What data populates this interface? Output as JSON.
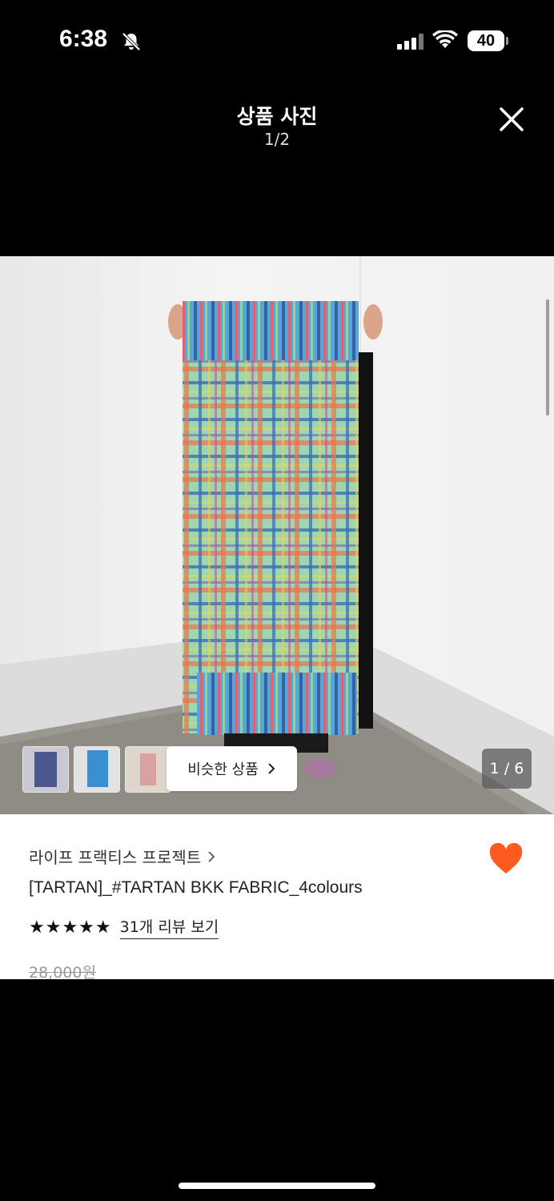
{
  "status_bar": {
    "time": "6:38",
    "battery": "40"
  },
  "header": {
    "title": "상품 사진",
    "counter": "1/2"
  },
  "photo": {
    "similar_label": "비슷한 상품",
    "counter": "1 / 6"
  },
  "product": {
    "brand": "라이프 프랙티스 프로젝트",
    "name": "[TARTAN]_#TARTAN BKK FABRIC_4colours",
    "stars": "★★★★★",
    "review_link": "31개 리뷰 보기",
    "original_price": "28,000원",
    "liked": true
  },
  "colors": {
    "accent": "#ff5a1f"
  }
}
